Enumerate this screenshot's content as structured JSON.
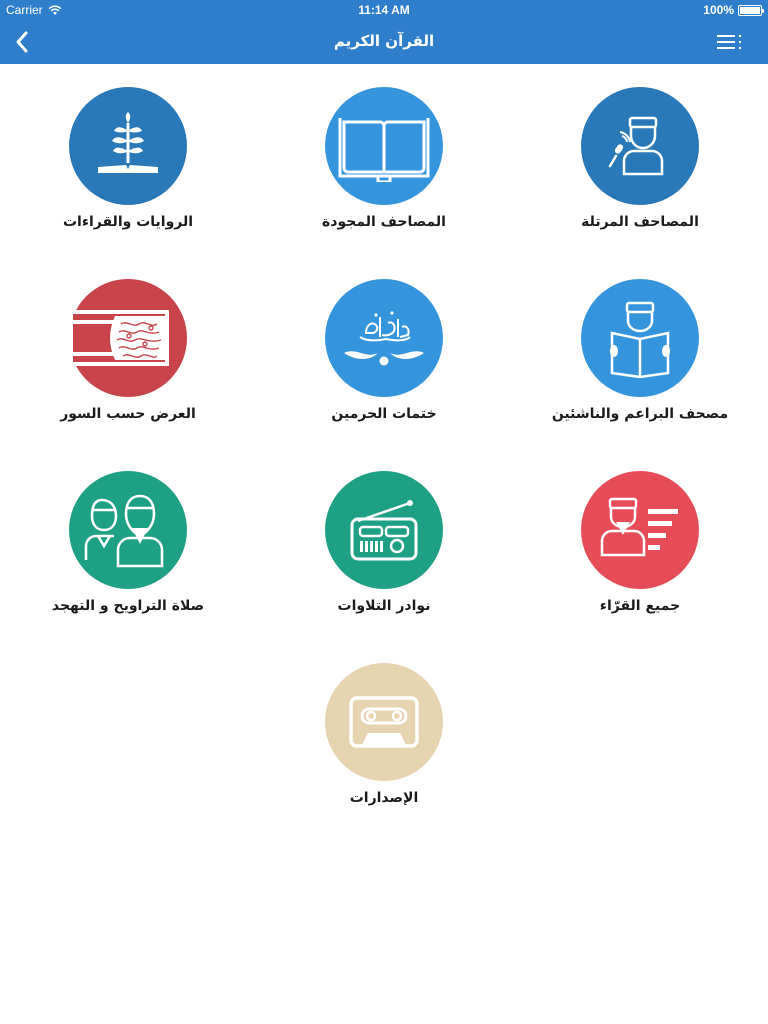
{
  "status_bar": {
    "carrier": "Carrier",
    "time": "11:14 AM",
    "battery": "100%"
  },
  "nav": {
    "title": "القرآن الكريم",
    "back_icon": "chevron-left-icon",
    "menu_icon": "list-menu-icon"
  },
  "colors": {
    "header": "#2f7ecb",
    "blue_dark": "#2979b9",
    "blue_light": "#3595dc",
    "red": "#c8434a",
    "red_light": "#e64c57",
    "green": "#1ea084",
    "beige": "#e6d4b0"
  },
  "tiles": [
    {
      "label": "المصاحف المرتلة",
      "icon": "reciter-microphone-icon",
      "color": "#2979b9"
    },
    {
      "label": "المصاحف المجودة",
      "icon": "open-book-icon",
      "color": "#3595dc"
    },
    {
      "label": "الروايات والقراءات",
      "icon": "book-plant-icon",
      "color": "#2979b9"
    },
    {
      "label": "مصحف البراعم والناشئين",
      "icon": "child-reading-icon",
      "color": "#3595dc"
    },
    {
      "label": "ختمات الحرمين",
      "icon": "quran-calligraphy-icon",
      "color": "#3595dc"
    },
    {
      "label": "العرض حسب السور",
      "icon": "surah-banner-icon",
      "color": "#c8434a"
    },
    {
      "label": "جميع القرّاء",
      "icon": "reciters-list-icon",
      "color": "#e64c57"
    },
    {
      "label": "نوادر التلاوات",
      "icon": "radio-icon",
      "color": "#1ea084"
    },
    {
      "label": "صلاة التراويح و التهجد",
      "icon": "two-imams-icon",
      "color": "#1ea084"
    },
    {
      "label": "الإصدارات",
      "icon": "cassette-icon",
      "color": "#e6d4b0"
    }
  ]
}
